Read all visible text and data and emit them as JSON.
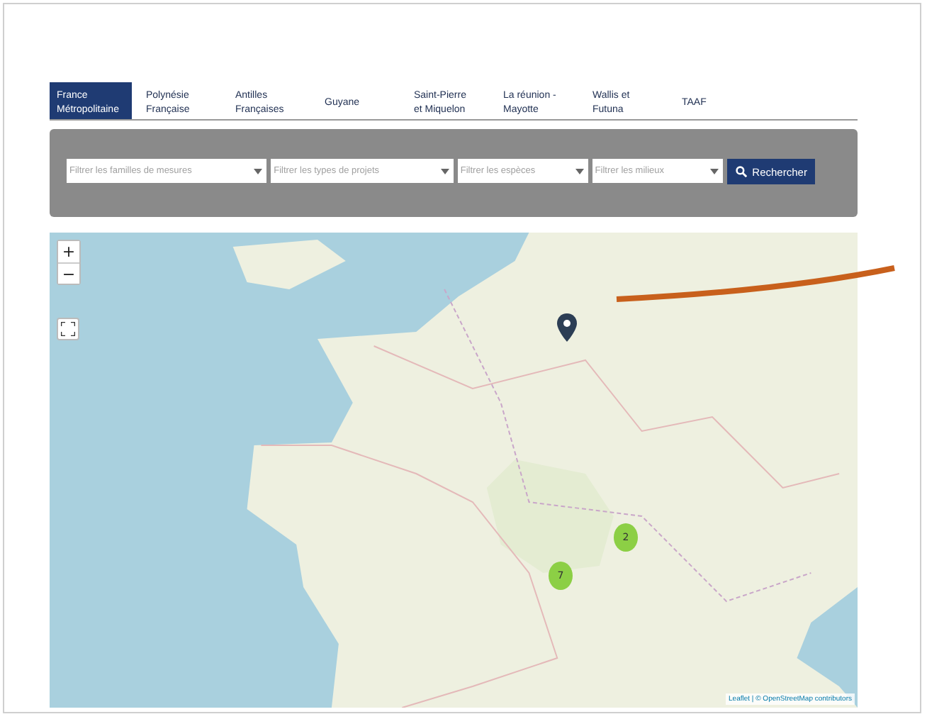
{
  "tabs": [
    {
      "label": "France\nMétropolitaine",
      "selected": true
    },
    {
      "label": "Polynésie\nFrançaise",
      "selected": false
    },
    {
      "label": "Antilles\nFrançaises",
      "selected": false
    },
    {
      "label": "Guyane",
      "selected": false
    },
    {
      "label": "Saint-Pierre\net Miquelon",
      "selected": false
    },
    {
      "label": "La réunion -\nMayotte",
      "selected": false
    },
    {
      "label": "Wallis et\nFutuna",
      "selected": false
    },
    {
      "label": "TAAF",
      "selected": false
    }
  ],
  "filters": [
    {
      "placeholder": "Filtrer les familles de mesures"
    },
    {
      "placeholder": "Filtrer les types de projets"
    },
    {
      "placeholder": "Filtrer les espèces"
    },
    {
      "placeholder": "Filtrer les milieux"
    }
  ],
  "search_button": "Rechercher",
  "map": {
    "zoom_in": "+",
    "zoom_out": "−",
    "clusters": [
      {
        "count": "2"
      },
      {
        "count": "7"
      }
    ],
    "attribution": "Leaflet | © OpenStreetMap contributors"
  }
}
